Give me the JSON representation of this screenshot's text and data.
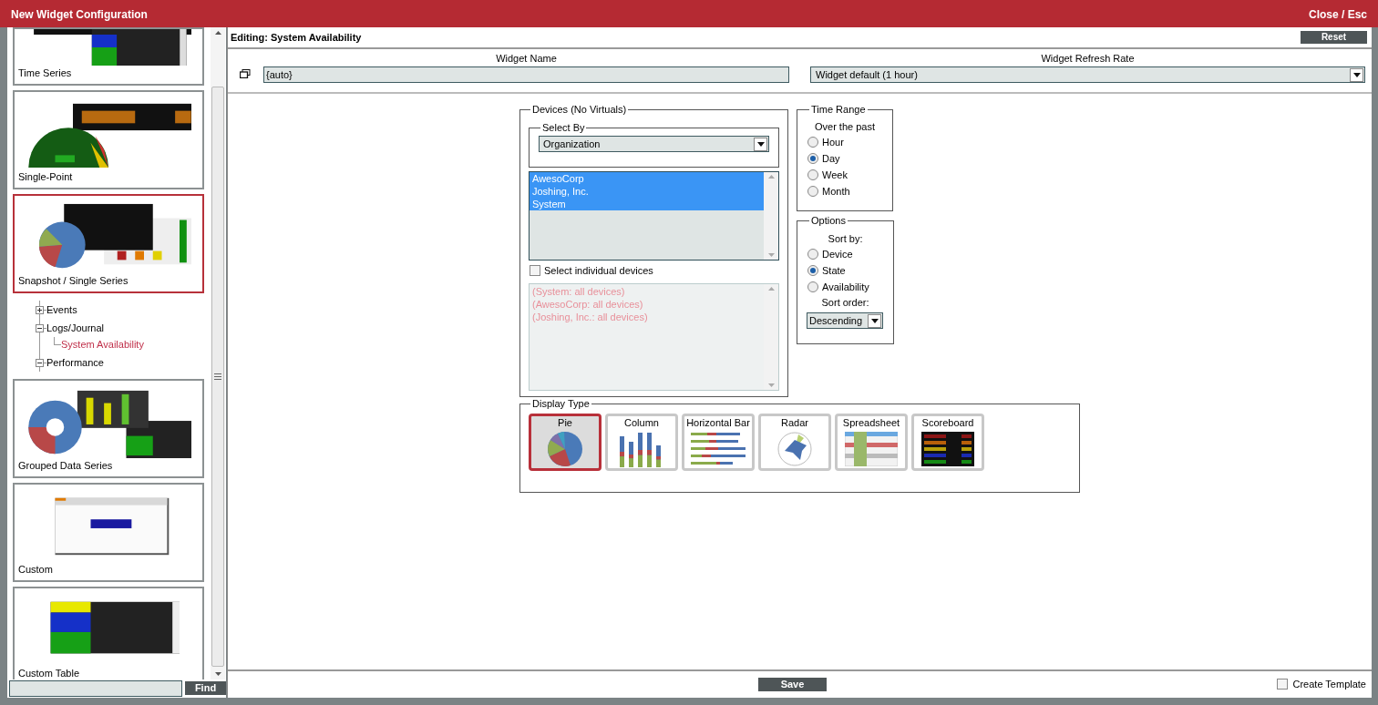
{
  "window": {
    "title": "New Widget Configuration",
    "close": "Close / Esc"
  },
  "sidebar": {
    "cards": [
      {
        "label": "Time Series",
        "selected": false
      },
      {
        "label": "Single-Point",
        "selected": false
      },
      {
        "label": "Snapshot / Single Series",
        "selected": true
      },
      {
        "label": "Grouped Data Series",
        "selected": false
      },
      {
        "label": "Custom",
        "selected": false
      },
      {
        "label": "Custom Table",
        "selected": false
      }
    ],
    "tree": [
      {
        "label": "Events",
        "expanded": false,
        "selected": false
      },
      {
        "label": "Logs/Journal",
        "expanded": true,
        "selected": false,
        "children": [
          {
            "label": "System Availability",
            "selected": true
          }
        ]
      },
      {
        "label": "Performance",
        "expanded": true,
        "selected": false
      }
    ],
    "find_button": "Find"
  },
  "editor": {
    "heading": "Editing: System Availability",
    "reset": "Reset",
    "widget_name": {
      "label": "Widget Name",
      "value": "{auto}"
    },
    "refresh_rate": {
      "label": "Widget Refresh Rate",
      "value": "Widget default (1 hour)"
    }
  },
  "devices": {
    "legend": "Devices (No Virtuals)",
    "select_by": {
      "legend": "Select By",
      "value": "Organization"
    },
    "organizations": [
      {
        "label": "AwesoCorp",
        "selected": true
      },
      {
        "label": "Joshing, Inc.",
        "selected": true
      },
      {
        "label": "System",
        "selected": true
      }
    ],
    "individual": {
      "label": "Select individual devices",
      "checked": false
    },
    "device_list": [
      "(System: all devices)",
      "(AwesoCorp: all devices)",
      "(Joshing, Inc.: all devices)"
    ]
  },
  "time_range": {
    "legend": "Time Range",
    "caption": "Over the past",
    "options": [
      {
        "label": "Hour",
        "selected": false
      },
      {
        "label": "Day",
        "selected": true
      },
      {
        "label": "Week",
        "selected": false
      },
      {
        "label": "Month",
        "selected": false
      }
    ]
  },
  "options": {
    "legend": "Options",
    "sort_by_label": "Sort by:",
    "sort_by": [
      {
        "label": "Device",
        "selected": false
      },
      {
        "label": "State",
        "selected": true
      },
      {
        "label": "Availability",
        "selected": false
      }
    ],
    "sort_order_label": "Sort order:",
    "sort_order": "Descending"
  },
  "display_type": {
    "legend": "Display Type",
    "types": [
      {
        "label": "Pie",
        "kind": "pie",
        "selected": true
      },
      {
        "label": "Column",
        "kind": "column",
        "selected": false
      },
      {
        "label": "Horizontal Bar",
        "kind": "bar",
        "selected": false
      },
      {
        "label": "Radar",
        "kind": "radar",
        "selected": false
      },
      {
        "label": "Spreadsheet",
        "kind": "spreadsheet",
        "selected": false
      },
      {
        "label": "Scoreboard",
        "kind": "scoreboard",
        "selected": false
      }
    ]
  },
  "footer": {
    "save": "Save",
    "create_template": {
      "label": "Create Template",
      "checked": false
    }
  }
}
